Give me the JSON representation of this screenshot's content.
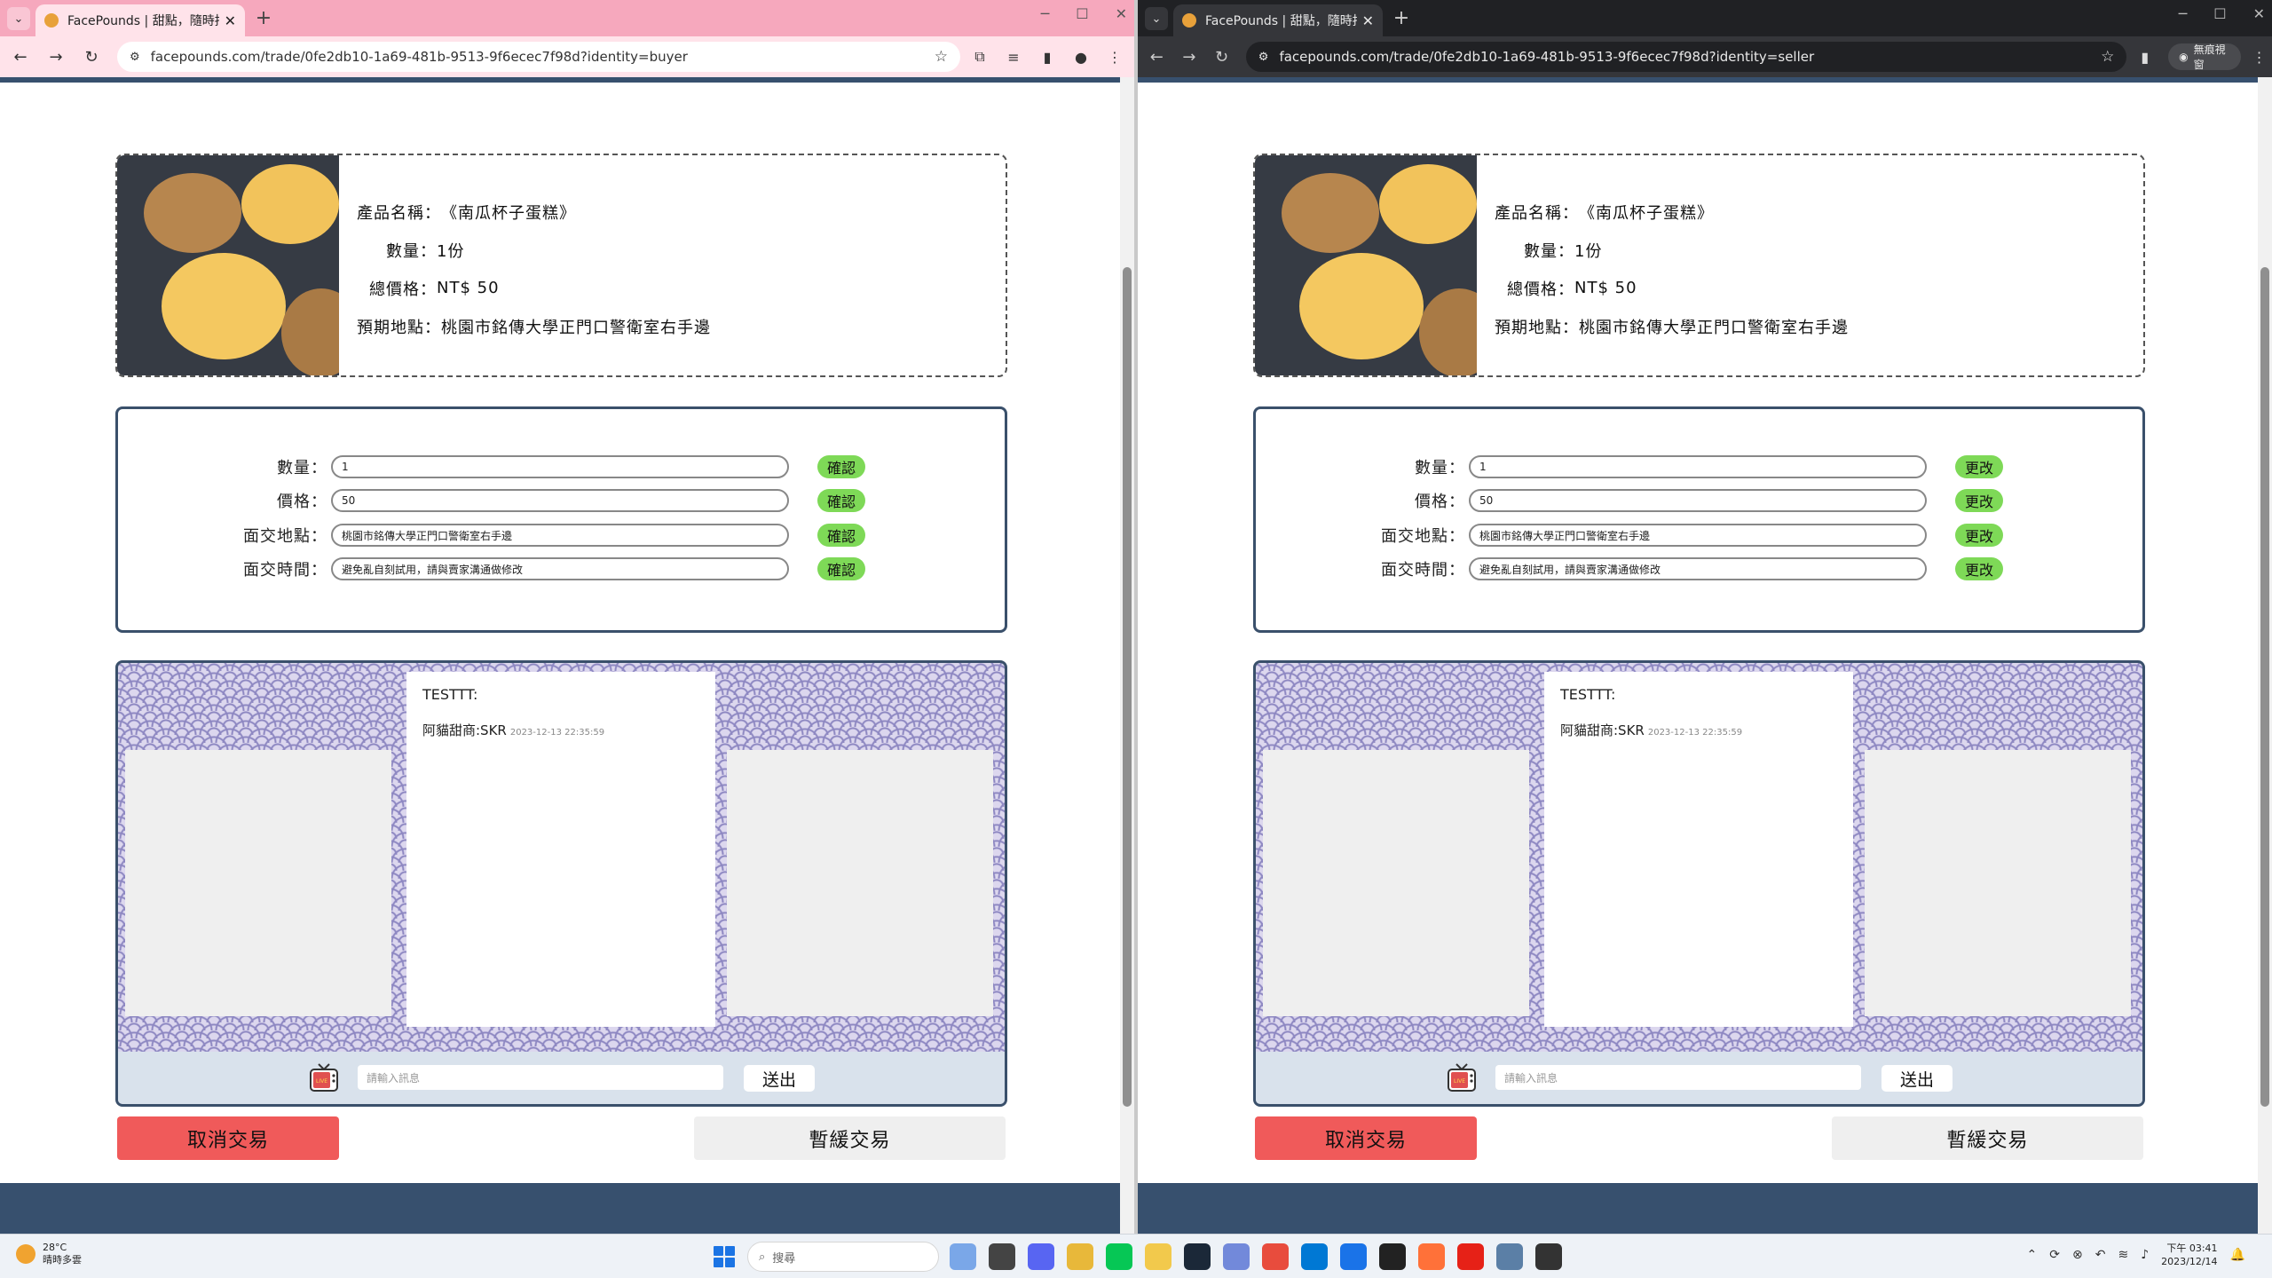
{
  "left_window": {
    "tab_title": "FacePounds | 甜點，隨時拍",
    "url": "facepounds.com/trade/0fe2db10-1a69-481b-9513-9f6ecec7f98d?identity=buyer",
    "action_label": "確認"
  },
  "right_window": {
    "tab_title": "FacePounds | 甜點，隨時拍",
    "url": "facepounds.com/trade/0fe2db10-1a69-481b-9513-9f6ecec7f98d?identity=seller",
    "incognito_label": "無痕視窗",
    "action_label": "更改"
  },
  "product": {
    "name_label": "產品名稱：",
    "name_value": "《南瓜杯子蛋糕》",
    "qty_label": "數量：",
    "qty_value": "1份",
    "price_label": "總價格：",
    "price_value": "NT$ 50",
    "place_label": "預期地點：",
    "place_value": "桃園市銘傳大學正門口警衛室右手邊"
  },
  "form": {
    "qty_label": "數量：",
    "qty_value": "1",
    "price_label": "價格：",
    "price_value": "50",
    "place_label": "面交地點：",
    "place_value": "桃園市銘傳大學正門口警衛室右手邊",
    "time_label": "面交時間：",
    "time_value": "避免亂自刻試用，請與賣家溝通做修改"
  },
  "chat": {
    "message1": "TESTTT:",
    "sender": "阿貓甜商:SKR",
    "timestamp": "2023-12-13 22:35:59",
    "input_placeholder": "請輸入訊息",
    "send_label": "送出",
    "tv_label": "LIVE"
  },
  "buttons": {
    "cancel_label": "取消交易",
    "pause_label": "暫緩交易"
  },
  "taskbar": {
    "temperature": "28°C",
    "weather": "晴時多雲",
    "search_placeholder": "搜尋",
    "time": "下午 03:41",
    "date": "2023/12/14"
  },
  "colors": {
    "navy": "#37506e",
    "confirm_green": "#7ed957",
    "cancel_red": "#f05a5a",
    "buyer_tabstrip": "#f6a8bd",
    "seller_tabstrip": "#202124"
  }
}
